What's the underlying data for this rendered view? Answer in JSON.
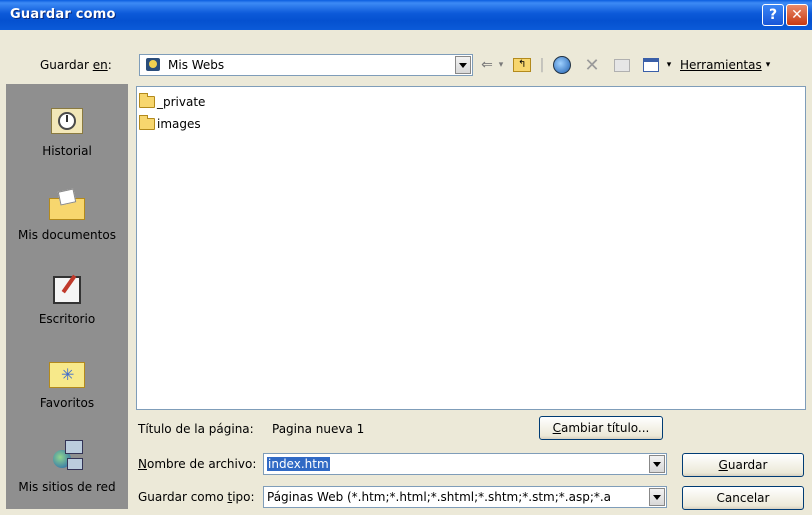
{
  "window": {
    "title": "Guardar como",
    "help_glyph": "?",
    "close_glyph": "✕"
  },
  "save_in": {
    "label_prefix": "Guardar ",
    "label_underlined": "en",
    "label_suffix": ":",
    "value": "Mis Webs"
  },
  "toolbar": {
    "tools_label": "Herramientas"
  },
  "places": [
    {
      "label": "Historial",
      "icon": "history-icon"
    },
    {
      "label": "Mis documentos",
      "icon": "my-documents-icon"
    },
    {
      "label": "Escritorio",
      "icon": "desktop-icon"
    },
    {
      "label": "Favoritos",
      "icon": "favorites-icon"
    },
    {
      "label": "Mis sitios de red",
      "icon": "network-places-icon"
    }
  ],
  "files": [
    {
      "name": "_private",
      "icon": "folder-icon"
    },
    {
      "name": "images",
      "icon": "folder-icon"
    }
  ],
  "page_title": {
    "label": "Título de la página:",
    "value": "Pagina nueva 1",
    "change_button_u": "C",
    "change_button_rest": "ambiar título..."
  },
  "filename": {
    "label_u": "N",
    "label_rest": "ombre de archivo:",
    "value": "index.htm"
  },
  "filetype": {
    "label_prefix": "Guardar como ",
    "label_u": "t",
    "label_rest": "ipo:",
    "value": "Páginas Web (*.htm;*.html;*.shtml;*.shtm;*.stm;*.asp;*.a"
  },
  "buttons": {
    "save_u": "G",
    "save_rest": "uardar",
    "cancel": "Cancelar"
  },
  "colors": {
    "titlebar": "#0551d0",
    "places_bg": "#8f8f8f",
    "dialog_bg": "#ece9d8",
    "selection": "#316ac5"
  }
}
